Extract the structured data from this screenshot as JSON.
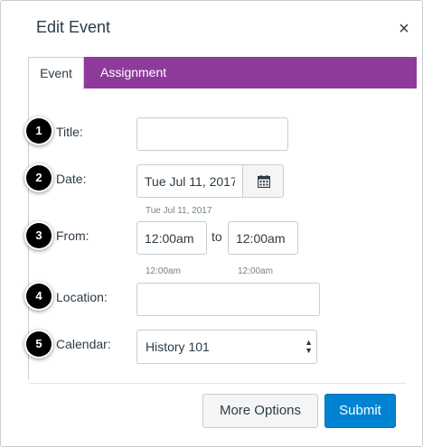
{
  "dialog": {
    "title": "Edit Event",
    "close_symbol": "×"
  },
  "tabs": [
    {
      "label": "Event",
      "selected": true
    },
    {
      "label": "Assignment",
      "selected": false
    }
  ],
  "form": {
    "title": {
      "step": "1",
      "label": "Title:",
      "value": ""
    },
    "date": {
      "step": "2",
      "label": "Date:",
      "value": "Tue Jul 11, 2017",
      "hint": "Tue Jul 11, 2017",
      "button_icon": "calendar-icon"
    },
    "time": {
      "step": "3",
      "label": "From:",
      "start_value": "12:00am",
      "separator": "to",
      "end_value": "12:00am",
      "start_hint": "12:00am",
      "end_hint": "12:00am"
    },
    "location": {
      "step": "4",
      "label": "Location:",
      "value": ""
    },
    "calendar": {
      "step": "5",
      "label": "Calendar:",
      "selected": "History 101",
      "arrow_up": "▲",
      "arrow_down": "▼"
    }
  },
  "footer": {
    "more_options_label": "More Options",
    "submit_label": "Submit"
  },
  "colors": {
    "tab_bar": "#8e3a9b",
    "submit_button": "#0084d1",
    "badge": "#000000"
  }
}
